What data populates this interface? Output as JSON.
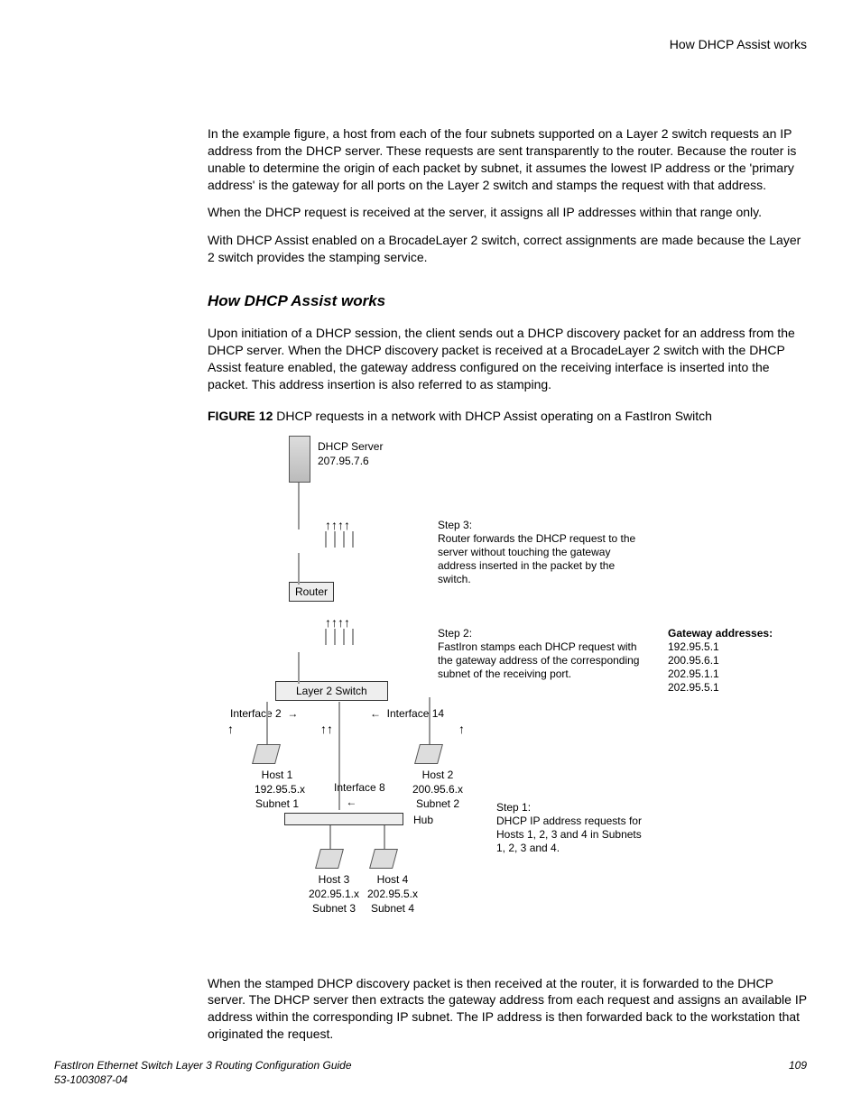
{
  "header": {
    "running": "How DHCP Assist works"
  },
  "intro": {
    "p1": "In the example figure, a host from each of the four subnets supported on a Layer 2 switch requests an IP address from the DHCP server. These requests are sent transparently to the router. Because the router is unable to determine the origin of each packet by subnet, it assumes the lowest IP address or the 'primary address' is the gateway for all ports on the Layer 2 switch and stamps the request with that address.",
    "p2": "When the DHCP request is received at the server, it assigns all IP addresses within that range only.",
    "p3": "With DHCP Assist enabled on a BrocadeLayer 2 switch, correct assignments are made because the Layer 2 switch provides the stamping service."
  },
  "section": {
    "heading": "How DHCP Assist works",
    "p1": "Upon initiation of a DHCP session, the client sends out a DHCP discovery packet for an address from the DHCP server. When the DHCP discovery packet is received at a BrocadeLayer 2 switch with the DHCP Assist feature enabled, the gateway address configured on the receiving interface is inserted into the packet. This address insertion is also referred to as stamping."
  },
  "figure": {
    "label": "FIGURE 12",
    "caption": "DHCP requests in a network with DHCP Assist operating on a FastIron Switch",
    "server_label": "DHCP Server",
    "server_ip": "207.95.7.6",
    "router_label": "Router",
    "switch_label": "Layer 2 Switch",
    "hub_label": "Hub",
    "iface2": "Interface 2",
    "iface14": "Interface 14",
    "iface8": "Interface 8",
    "host1": "Host 1",
    "host1_ip": "192.95.5.x",
    "host1_sub": "Subnet 1",
    "host2": "Host 2",
    "host2_ip": "200.95.6.x",
    "host2_sub": "Subnet 2",
    "host3": "Host 3",
    "host3_ip": "202.95.1.x",
    "host3_sub": "Subnet 3",
    "host4": "Host 4",
    "host4_ip": "202.95.5.x",
    "host4_sub": "Subnet 4",
    "step1_hdr": "Step 1:",
    "step1_txt": "DHCP IP address requests for Hosts 1, 2, 3 and 4 in Subnets 1, 2, 3 and 4.",
    "step2_hdr": "Step 2:",
    "step2_txt": "FastIron stamps each DHCP request with the gateway address of the corresponding subnet of the receiving port.",
    "step3_hdr": "Step 3:",
    "step3_txt": "Router forwards the DHCP request to the server without touching the gateway address inserted in the packet by the switch.",
    "gw_hdr": "Gateway addresses:",
    "gw1": "192.95.5.1",
    "gw2": "200.95.6.1",
    "gw3": "202.95.1.1",
    "gw4": "202.95.5.1"
  },
  "after": {
    "p1": "When the stamped DHCP discovery packet is then received at the router, it is forwarded to the DHCP server. The DHCP server then extracts the gateway address from each request and assigns an available IP address within the corresponding IP subnet. The IP address is then forwarded back to the workstation that originated the request."
  },
  "footer": {
    "title": "FastIron Ethernet Switch Layer 3 Routing Configuration Guide",
    "docnum": "53-1003087-04",
    "page": "109"
  }
}
